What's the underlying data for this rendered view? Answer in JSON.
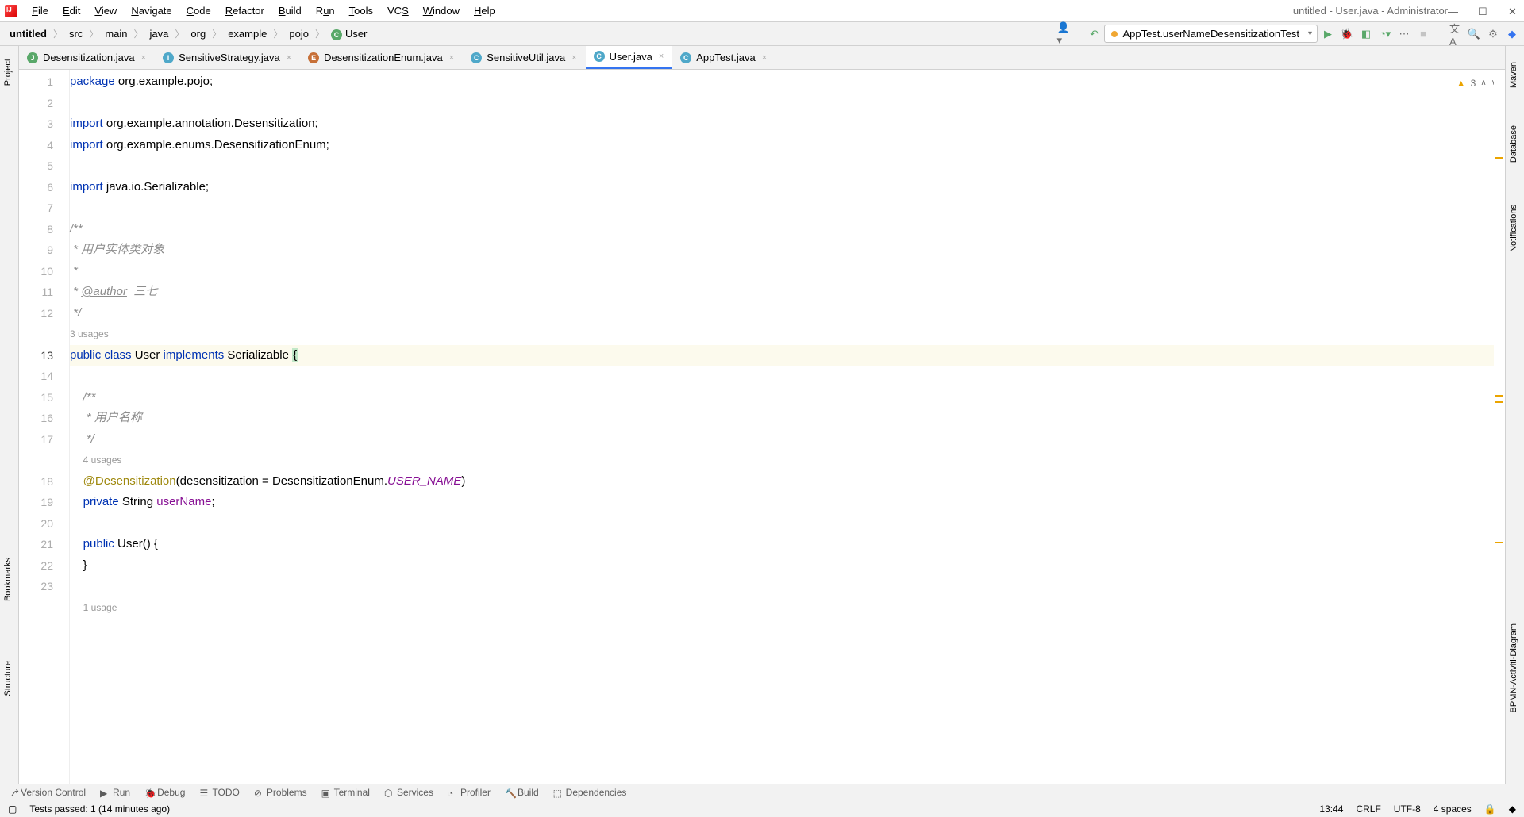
{
  "window": {
    "title": "untitled - User.java - Administrator"
  },
  "menu": {
    "file": "File",
    "edit": "Edit",
    "view": "View",
    "navigate": "Navigate",
    "code": "Code",
    "refactor": "Refactor",
    "build": "Build",
    "run": "Run",
    "tools": "Tools",
    "vcs": "VCS",
    "window": "Window",
    "help": "Help"
  },
  "breadcrumb": {
    "project": "untitled",
    "parts": [
      "src",
      "main",
      "java",
      "org",
      "example",
      "pojo"
    ],
    "class": "User"
  },
  "run_config": {
    "label": "AppTest.userNameDesensitizationTest"
  },
  "tabs": [
    {
      "name": "Desensitization.java",
      "icon": "green"
    },
    {
      "name": "SensitiveStrategy.java",
      "icon": "cyan"
    },
    {
      "name": "DesensitizationEnum.java",
      "icon": "enum"
    },
    {
      "name": "SensitiveUtil.java",
      "icon": "cyan"
    },
    {
      "name": "User.java",
      "icon": "cyan",
      "active": true
    },
    {
      "name": "AppTest.java",
      "icon": "cyan"
    }
  ],
  "inspection": {
    "warnings": "3"
  },
  "gutter": {
    "lines": [
      "1",
      "2",
      "3",
      "4",
      "5",
      "6",
      "7",
      "8",
      "9",
      "10",
      "11",
      "12",
      "",
      "13",
      "14",
      "15",
      "16",
      "17",
      "",
      "18",
      "19",
      "20",
      "21",
      "22",
      "23",
      ""
    ],
    "current": "13",
    "usages_1": "3 usages",
    "usages_2": "4 usages",
    "usages_3": "1 usage"
  },
  "code": {
    "l1_pkg": "package",
    "l1_rest": " org.example.pojo;",
    "l3_kw": "import",
    "l3_p1": " org.example.annotation.",
    "l3_p2": "Desensitization",
    "l3_p3": ";",
    "l4_kw": "import",
    "l4_rest": " org.example.enums.DesensitizationEnum;",
    "l6_kw": "import",
    "l6_rest": " java.io.Serializable;",
    "l8": "/**",
    "l9": " * 用户实体类对象",
    "l10": " *",
    "l11_a": " * ",
    "l11_tag": "@author",
    "l11_b": "  三七",
    "l12": " */",
    "l13_pub": "public ",
    "l13_cls": "class ",
    "l13_name": "User ",
    "l13_impl": "implements ",
    "l13_ser": "Serializable ",
    "l13_brace": "{",
    "l15": "    /**",
    "l16": "     * 用户名称",
    "l17": "     */",
    "l18_a": "    ",
    "l18_ann": "@Desensitization",
    "l18_b": "(desensitization = DesensitizationEnum.",
    "l18_c": "USER_NAME",
    "l18_d": ")",
    "l19_a": "    ",
    "l19_priv": "private ",
    "l19_type": "String ",
    "l19_field": "userName",
    "l19_semi": ";",
    "l21_a": "    ",
    "l21_pub": "public ",
    "l21_name": "User",
    "l21_rest": "() {",
    "l22": "    }"
  },
  "left_tools": {
    "project": "Project",
    "bookmarks": "Bookmarks",
    "structure": "Structure"
  },
  "right_tools": {
    "maven": "Maven",
    "database": "Database",
    "notif": "Notifications",
    "bpmn": "BPMN-Activiti-Diagram"
  },
  "bottom_tools": {
    "vc": "Version Control",
    "run": "Run",
    "debug": "Debug",
    "todo": "TODO",
    "problems": "Problems",
    "terminal": "Terminal",
    "services": "Services",
    "profiler": "Profiler",
    "build": "Build",
    "deps": "Dependencies"
  },
  "status": {
    "msg": "Tests passed: 1 (14 minutes ago)",
    "pos": "13:44",
    "sep": "CRLF",
    "enc": "UTF-8",
    "indent": "4 spaces"
  }
}
